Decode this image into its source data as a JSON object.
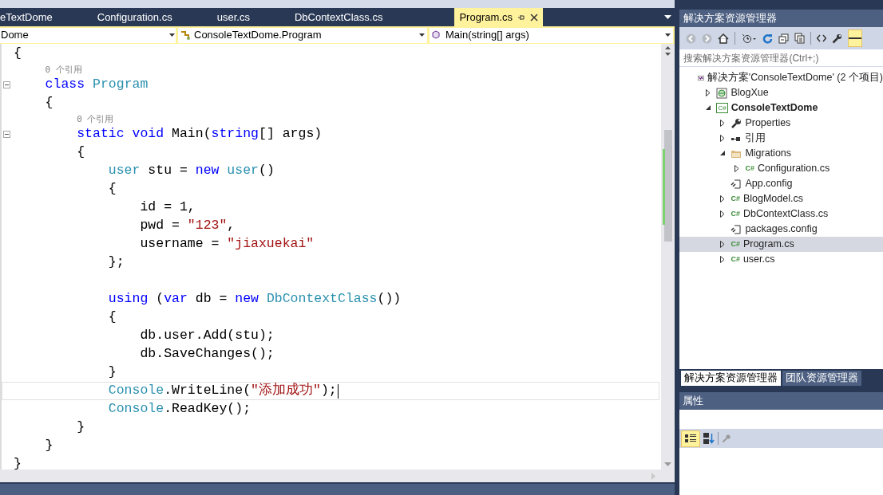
{
  "editor_tabs": [
    {
      "label": "eTextDome",
      "selected": false
    },
    {
      "label": "Configuration.cs",
      "selected": false
    },
    {
      "label": "user.cs",
      "selected": false
    },
    {
      "label": "DbContextClass.cs",
      "selected": false
    },
    {
      "label": "Program.cs",
      "selected": true
    }
  ],
  "navigation": {
    "project": "Dome",
    "class": "ConsoleTextDome.Program",
    "member": "Main(string[] args)"
  },
  "code_lines": [
    {
      "tokens": [
        {
          "text": "{",
          "kind": "plain"
        }
      ]
    },
    {
      "lens": "0 个引用",
      "fold": true,
      "tokens": [
        {
          "text": "    class",
          "kind": "keyword"
        },
        {
          "text": " Program",
          "kind": "type"
        }
      ]
    },
    {
      "tokens": [
        {
          "text": "    {",
          "kind": "plain"
        }
      ]
    },
    {
      "lens": "0 个引用",
      "fold": true,
      "tokens": [
        {
          "text": "        static",
          "kind": "keyword"
        },
        {
          "text": " void",
          "kind": "keyword"
        },
        {
          "text": " Main(",
          "kind": "plain"
        },
        {
          "text": "string",
          "kind": "keyword"
        },
        {
          "text": "[] args)",
          "kind": "plain"
        }
      ]
    },
    {
      "tokens": [
        {
          "text": "        {",
          "kind": "plain"
        }
      ]
    },
    {
      "tokens": [
        {
          "text": "            user",
          "kind": "type"
        },
        {
          "text": " stu = ",
          "kind": "plain"
        },
        {
          "text": "new",
          "kind": "keyword"
        },
        {
          "text": " user",
          "kind": "type"
        },
        {
          "text": "()",
          "kind": "plain"
        }
      ]
    },
    {
      "tokens": [
        {
          "text": "            {",
          "kind": "plain"
        }
      ]
    },
    {
      "tokens": [
        {
          "text": "                id = 1,",
          "kind": "plain"
        }
      ]
    },
    {
      "tokens": [
        {
          "text": "                pwd = ",
          "kind": "plain"
        },
        {
          "text": "\"123\"",
          "kind": "string"
        },
        {
          "text": ",",
          "kind": "plain"
        }
      ]
    },
    {
      "tokens": [
        {
          "text": "                username = ",
          "kind": "plain"
        },
        {
          "text": "\"jiaxuekai\"",
          "kind": "string"
        }
      ]
    },
    {
      "gap_after": true,
      "tokens": [
        {
          "text": "            };",
          "kind": "plain"
        }
      ]
    },
    {
      "tokens": [
        {
          "text": "            using",
          "kind": "keyword"
        },
        {
          "text": " (",
          "kind": "plain"
        },
        {
          "text": "var",
          "kind": "keyword"
        },
        {
          "text": " db = ",
          "kind": "plain"
        },
        {
          "text": "new",
          "kind": "keyword"
        },
        {
          "text": " DbContextClass",
          "kind": "type"
        },
        {
          "text": "())",
          "kind": "plain"
        }
      ]
    },
    {
      "tokens": [
        {
          "text": "            {",
          "kind": "plain"
        }
      ]
    },
    {
      "tokens": [
        {
          "text": "                db.user.Add(stu);",
          "kind": "plain"
        }
      ]
    },
    {
      "tokens": [
        {
          "text": "                db.SaveChanges();",
          "kind": "plain"
        }
      ]
    },
    {
      "tokens": [
        {
          "text": "            }",
          "kind": "plain"
        }
      ]
    },
    {
      "current": true,
      "tokens": [
        {
          "text": "            Console",
          "kind": "type"
        },
        {
          "text": ".WriteLine(",
          "kind": "plain"
        },
        {
          "text": "\"添加成功\"",
          "kind": "string"
        },
        {
          "text": ");",
          "kind": "plain"
        }
      ]
    },
    {
      "tokens": [
        {
          "text": "            Console",
          "kind": "type"
        },
        {
          "text": ".ReadKey();",
          "kind": "plain"
        }
      ]
    },
    {
      "tokens": [
        {
          "text": "        }",
          "kind": "plain"
        }
      ]
    },
    {
      "tokens": [
        {
          "text": "    }",
          "kind": "plain"
        }
      ]
    },
    {
      "tokens": [
        {
          "text": "}",
          "kind": "plain"
        }
      ]
    }
  ],
  "solution_explorer": {
    "title": "解决方案资源管理器",
    "search": {
      "placeholder": "搜索解决方案资源管理器(Ctrl+;)"
    },
    "tree": [
      {
        "label": "解决方案'ConsoleTextDome' (2 个项目)",
        "kind": "solution",
        "selected": false,
        "children": [
          {
            "label": "BlogXue",
            "kind": "web-project",
            "expanded": false,
            "selected": false
          },
          {
            "label": "ConsoleTextDome",
            "kind": "cs-project",
            "badge": "C#",
            "expanded": true,
            "selected": false,
            "children": [
              {
                "label": "Properties",
                "kind": "wrench",
                "expanded": false,
                "selected": false
              },
              {
                "label": "引用",
                "kind": "references",
                "expanded": false,
                "selected": false
              },
              {
                "label": "Migrations",
                "kind": "folder",
                "expanded": true,
                "selected": false,
                "children": [
                  {
                    "label": "Configuration.cs",
                    "kind": "cs",
                    "badge": "C#",
                    "expanded": false,
                    "selected": false
                  }
                ]
              },
              {
                "label": "App.config",
                "kind": "config",
                "selected": false
              },
              {
                "label": "BlogModel.cs",
                "kind": "cs",
                "badge": "C#",
                "expanded": false,
                "selected": false
              },
              {
                "label": "DbContextClass.cs",
                "kind": "cs",
                "badge": "C#",
                "expanded": false,
                "selected": false
              },
              {
                "label": "packages.config",
                "kind": "config",
                "selected": false
              },
              {
                "label": "Program.cs",
                "kind": "cs",
                "badge": "C#",
                "expanded": false,
                "selected": true
              },
              {
                "label": "user.cs",
                "kind": "cs",
                "badge": "C#",
                "expanded": false,
                "selected": false
              }
            ]
          }
        ]
      }
    ]
  },
  "panel_tabs": [
    {
      "label": "解决方案资源管理器",
      "selected": true
    },
    {
      "label": "团队资源管理器",
      "selected": false
    }
  ],
  "properties": {
    "title": "属性"
  }
}
